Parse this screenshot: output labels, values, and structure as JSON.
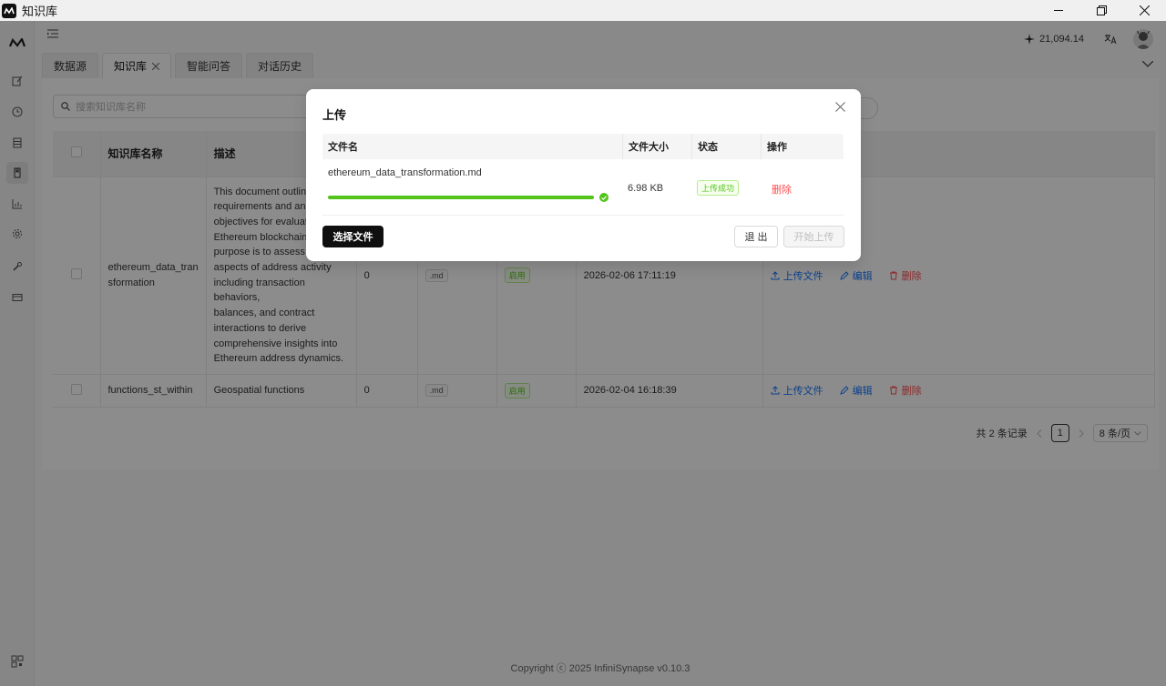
{
  "window": {
    "title": "知识库"
  },
  "header": {
    "credit_value": "21,094.14"
  },
  "tabs": [
    {
      "label": "数据源"
    },
    {
      "label": "知识库",
      "active": true
    },
    {
      "label": "智能问答"
    },
    {
      "label": "对话历史"
    }
  ],
  "search": {
    "placeholder": "搜索知识库名称"
  },
  "table": {
    "columns": [
      "知识库名称",
      "描述"
    ],
    "rows": [
      {
        "name": "ethereum_data_transformation",
        "name_line1": "ethereum_data_tran",
        "name_line2": "sformation",
        "description_lines": [
          "This document outlines",
          "requirements and analy",
          "objectives for evaluatin",
          "Ethereum blockchain da",
          "purpose is to assess var",
          "aspects of address activity",
          "including transaction behaviors,",
          "balances, and contract",
          "interactions to derive",
          "comprehensive insights into",
          "Ethereum address dynamics."
        ],
        "count": "0",
        "file_type": ".md",
        "status": "启用",
        "created": "2026-02-06 17:11:19"
      },
      {
        "name": "functions_st_within",
        "description": "Geospatial functions",
        "count": "0",
        "file_type": ".md",
        "status": "启用",
        "created": "2026-02-04 16:18:39"
      }
    ],
    "actions": {
      "upload": "上传文件",
      "edit": "编辑",
      "delete": "删除"
    }
  },
  "pagination": {
    "total_text": "共 2 条记录",
    "current_page": "1",
    "page_size": "8 条/页"
  },
  "footer": {
    "copyright": "Copyright ⓒ 2025 InfiniSynapse v0.10.3"
  },
  "upload_modal": {
    "title": "上传",
    "columns": {
      "filename": "文件名",
      "size": "文件大小",
      "status": "状态",
      "action": "操作"
    },
    "file": {
      "name": "ethereum_data_transformation.md",
      "size": "6.98 KB",
      "status": "上传成功",
      "action": "删除",
      "progress_percent": 100
    },
    "select_button": "选择文件",
    "exit_button": "退 出",
    "start_button": "开始上传"
  },
  "colors": {
    "success": "#52c41a",
    "link": "#1677ff",
    "danger": "#ff4d4f",
    "primary_dark": "#0f0f0f"
  }
}
